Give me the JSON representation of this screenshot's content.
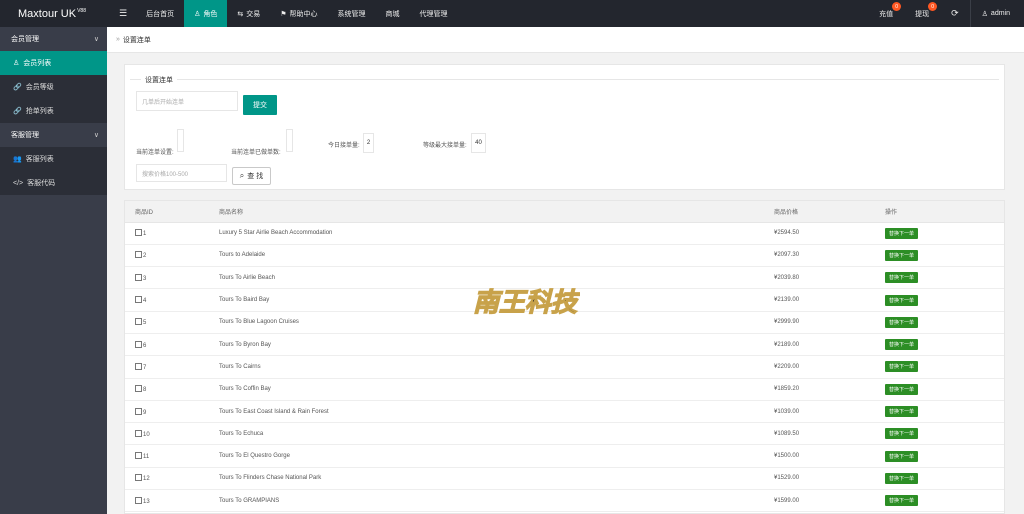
{
  "app": {
    "brand": "Maxtour UK",
    "version": "V88"
  },
  "topnav": {
    "menu_icon": "hamburger-icon",
    "items": [
      {
        "label": "后台首页",
        "icon": "",
        "active": false
      },
      {
        "label": "角色",
        "icon": "user-icon",
        "active": true
      },
      {
        "label": "交易",
        "icon": "trade-icon",
        "active": false
      },
      {
        "label": "帮助中心",
        "icon": "flag-icon",
        "active": false
      },
      {
        "label": "系统管理",
        "icon": "",
        "active": false
      },
      {
        "label": "商城",
        "icon": "",
        "active": false
      },
      {
        "label": "代理管理",
        "icon": "",
        "active": false
      }
    ],
    "right": {
      "recharge": "充值",
      "recharge_badge": "0",
      "withdraw": "提现",
      "withdraw_badge": "0",
      "refresh_icon": "refresh-icon",
      "user": "admin"
    }
  },
  "sidebar": {
    "groups": [
      {
        "label": "会员管理",
        "items": [
          {
            "label": "会员列表",
            "icon": "user-icon",
            "active": true
          },
          {
            "label": "会员等级",
            "icon": "link-icon",
            "active": false
          },
          {
            "label": "抢单列表",
            "icon": "link-icon",
            "active": false
          }
        ]
      },
      {
        "label": "客服管理",
        "items": [
          {
            "label": "客服列表",
            "icon": "users-icon",
            "active": false
          },
          {
            "label": "客服代码",
            "icon": "code-icon",
            "active": false
          }
        ]
      }
    ]
  },
  "breadcrumb": {
    "label": "设置连单"
  },
  "settings": {
    "legend": "设置连单",
    "start_placeholder": "几单后开始连单",
    "submit_label": "提交",
    "current_setting_label": "当前连单设置:",
    "current_done_label": "当前连单已做单数:",
    "today_orders_label": "今日接单量:",
    "today_orders_value": "2",
    "max_orders_label": "等级最大接单量:",
    "max_orders_value": "40",
    "price_placeholder": "搜索价格100-500",
    "search_label": "查 找"
  },
  "table": {
    "headers": [
      "商品ID",
      "商品名称",
      "商品价格",
      "操作"
    ],
    "action_label": "替换下一单",
    "rows": [
      {
        "id": "1",
        "name": "Luxury 5 Star Airlie Beach Accommodation",
        "price": "¥2594.50"
      },
      {
        "id": "2",
        "name": "Tours to Adelaide",
        "price": "¥2097.30"
      },
      {
        "id": "3",
        "name": "Tours To Airlie Beach",
        "price": "¥2039.80"
      },
      {
        "id": "4",
        "name": "Tours To Baird Bay",
        "price": "¥2139.00"
      },
      {
        "id": "5",
        "name": "Tours To Blue Lagoon Cruises",
        "price": "¥2999.90"
      },
      {
        "id": "6",
        "name": "Tours To Byron Bay",
        "price": "¥2189.00"
      },
      {
        "id": "7",
        "name": "Tours To Cairns",
        "price": "¥2209.00"
      },
      {
        "id": "8",
        "name": "Tours To Coffin Bay",
        "price": "¥1859.20"
      },
      {
        "id": "9",
        "name": "Tours To East Coast Island & Rain Forest",
        "price": "¥1039.00"
      },
      {
        "id": "10",
        "name": "Tours To Echuca",
        "price": "¥1089.50"
      },
      {
        "id": "11",
        "name": "Tours To El Questro Gorge",
        "price": "¥1500.00"
      },
      {
        "id": "12",
        "name": "Tours To Flinders Chase National Park",
        "price": "¥1529.00"
      },
      {
        "id": "13",
        "name": "Tours To GRAMPIANS",
        "price": "¥1599.00"
      }
    ]
  },
  "watermark": {
    "text": "南王科技",
    "color": "#c8a24a"
  }
}
